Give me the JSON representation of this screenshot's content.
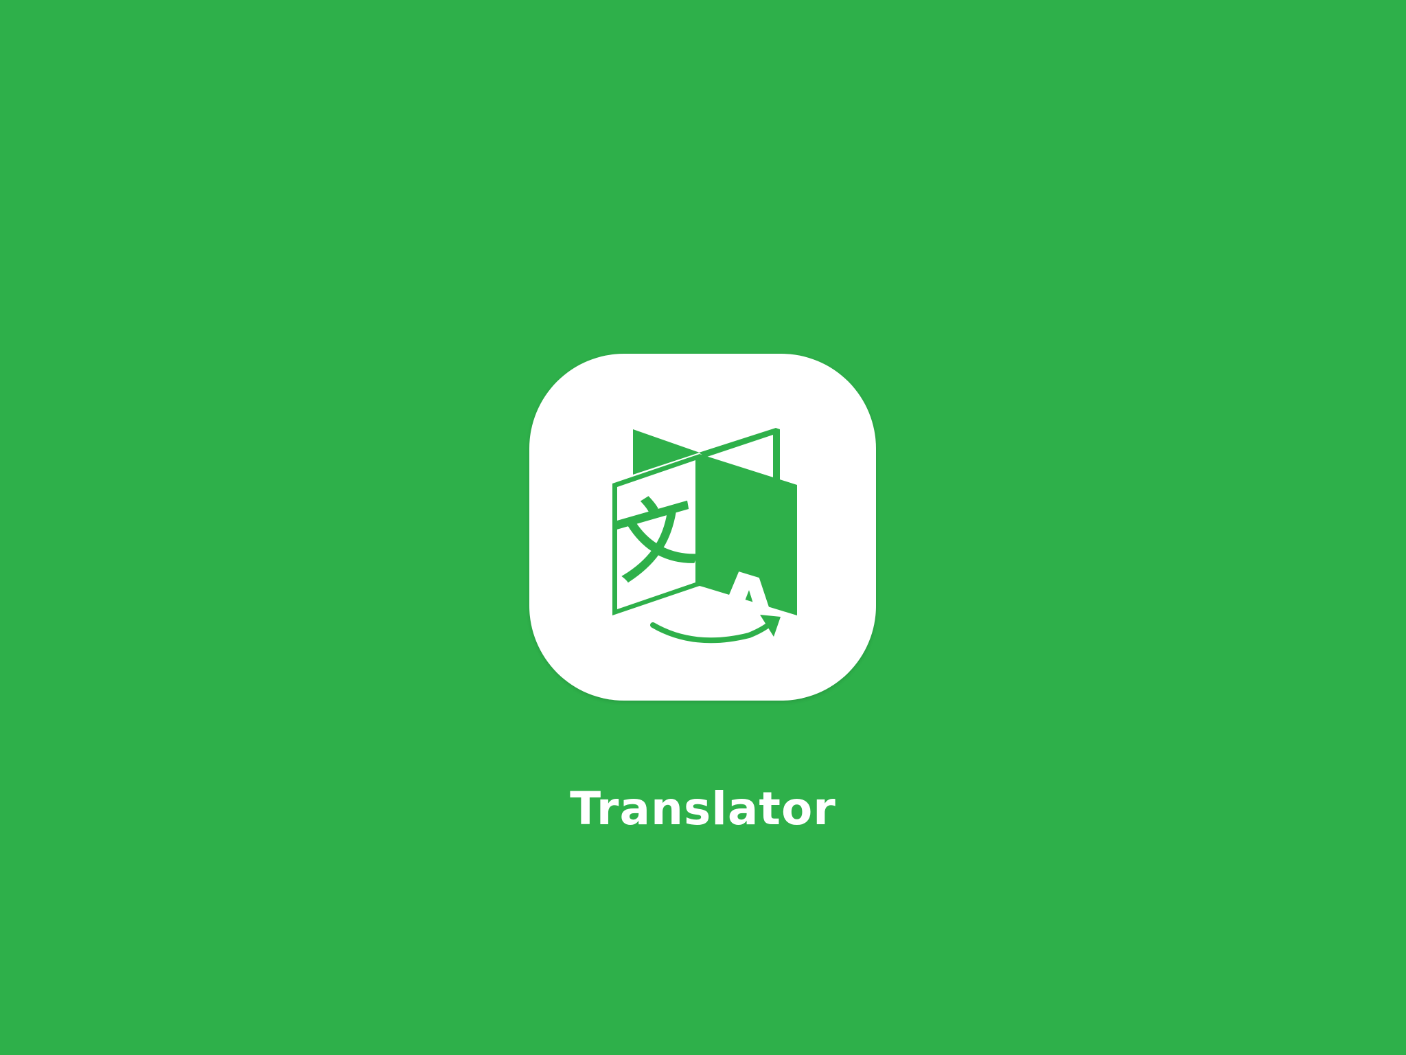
{
  "app": {
    "name": "Translator",
    "icon": "translator-book-icon",
    "glyphs": {
      "source": "文",
      "target": "A"
    }
  },
  "colors": {
    "background": "#2eb04a",
    "tile": "#ffffff",
    "icon": "#2eb04a",
    "text": "#ffffff"
  }
}
